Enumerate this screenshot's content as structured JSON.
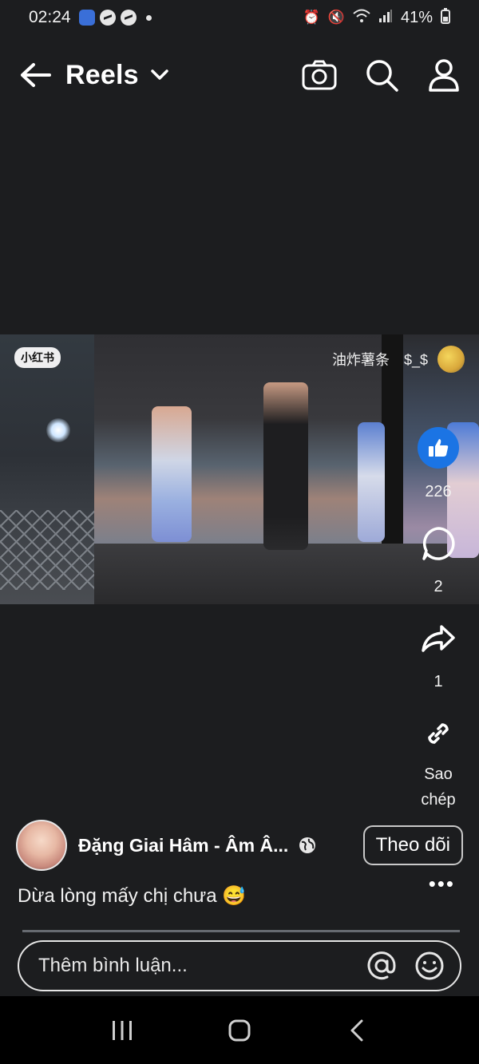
{
  "status_bar": {
    "time": "02:24",
    "battery": "41%"
  },
  "top_bar": {
    "title": "Reels"
  },
  "video": {
    "watermark_left": "小红书",
    "watermark_right": "油炸薯条　$_$"
  },
  "actions": {
    "like_count": "226",
    "comment_count": "2",
    "share_count": "1",
    "copy_label": "Sao chép"
  },
  "post": {
    "author": "Đặng Giai Hâm - Âm Â...",
    "follow_label": "Theo dõi",
    "caption": "Dừa lòng mấy chị chưa 😅"
  },
  "comment": {
    "placeholder": "Thêm bình luận..."
  },
  "colors": {
    "background": "#1c1d1f",
    "like_blue": "#1b74e4"
  },
  "icons": {
    "back": "back-arrow-icon",
    "dropdown": "chevron-down-icon",
    "camera": "camera-icon",
    "search": "search-icon",
    "profile": "profile-icon",
    "like": "thumbs-up-icon",
    "comment": "comment-icon",
    "share": "share-icon",
    "copy": "link-icon",
    "more": "more-icon",
    "globe": "globe-icon",
    "mention": "at-icon",
    "emoji": "emoji-icon"
  }
}
